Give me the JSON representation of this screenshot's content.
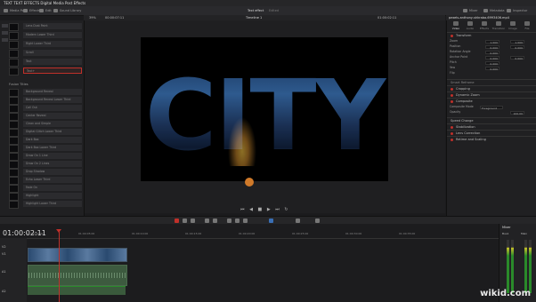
{
  "window": {
    "title": "TEXT TEXT EFFECTS Digital Media Post Effects"
  },
  "toolbar": {
    "items": [
      {
        "label": "Media Pool",
        "icon": "media-pool-icon"
      },
      {
        "label": "Effects",
        "icon": "effects-icon"
      },
      {
        "label": "Edit",
        "icon": "edit-index-icon"
      },
      {
        "label": "Sound Library",
        "icon": "sound-library-icon"
      }
    ],
    "center_title": "Text effect",
    "center_sub": "Edited",
    "right_items": [
      {
        "label": "Mixer",
        "icon": "mixer-icon"
      },
      {
        "label": "Metadata",
        "icon": "metadata-icon"
      },
      {
        "label": "Inspector",
        "icon": "inspector-icon"
      }
    ]
  },
  "viewer": {
    "zoom": "39%",
    "timecode_left": "00:00:07:11",
    "timeline_name": "Timeline 1",
    "timecode_right": "01:00:02:11",
    "overlay_text": "CITY"
  },
  "inspector": {
    "file": "pexels-anthony-shkraba-6993406.mp4",
    "tabs": [
      "Video",
      "Audio",
      "Effects",
      "Transition",
      "Image",
      "File"
    ],
    "transform": {
      "title": "Transform",
      "rows": [
        {
          "label": "Zoom",
          "x": "1.000",
          "y": "1.000"
        },
        {
          "label": "Position",
          "x": "0.000",
          "y": "0.000"
        },
        {
          "label": "Rotation Angle",
          "x": "0.000",
          "y": ""
        },
        {
          "label": "Anchor Point",
          "x": "0.000",
          "y": "0.000"
        },
        {
          "label": "Pitch",
          "x": "0.000",
          "y": ""
        },
        {
          "label": "Yaw",
          "x": "0.000",
          "y": ""
        },
        {
          "label": "Flip",
          "x": "",
          "y": ""
        }
      ]
    },
    "sections": [
      "Smart Reframe",
      "Cropping",
      "Dynamic Zoom",
      "Composite",
      "Speed Change",
      "Stabilization",
      "Lens Correction",
      "Retime and Scaling"
    ],
    "composite": {
      "mode_label": "Composite Mode",
      "mode_value": "Foreground",
      "opacity_label": "Opacity",
      "opacity_value": "100.00"
    }
  },
  "effects_panel": {
    "section_top": [
      "Lens Dust Paint",
      "Modern Lower Third",
      "Right Lower Third",
      "Scroll",
      "Text",
      "Text+"
    ],
    "selected_index": 5,
    "section_header": "Fusion Titles",
    "section_items": [
      "Background Reveal",
      "Background Reveal Lower Third",
      "Call Out",
      "Center Reveal",
      "Clean and Simple",
      "Digital Glitch Lower Third",
      "Dark Box",
      "Dark Box Lower Third",
      "Draw On 1 Line",
      "Draw On 2 Lines",
      "Drop Shadow",
      "Echo Lower Third",
      "Fade On",
      "Highlight",
      "Highlight Lower Third"
    ]
  },
  "timeline": {
    "timecode": "01:00:02:11",
    "ruler": [
      "01:00:00:00",
      "01:00:05:00",
      "01:00:10:00",
      "01:00:15:00",
      "01:00:20:00",
      "01:00:25:00",
      "01:00:30:00",
      "01:00:35:00"
    ],
    "tracks": [
      "V2",
      "V1",
      "A1",
      "A2"
    ]
  },
  "mixer": {
    "title": "Mixer",
    "channel": "Bus1",
    "main": "Main"
  },
  "watermark": "wikid.com"
}
